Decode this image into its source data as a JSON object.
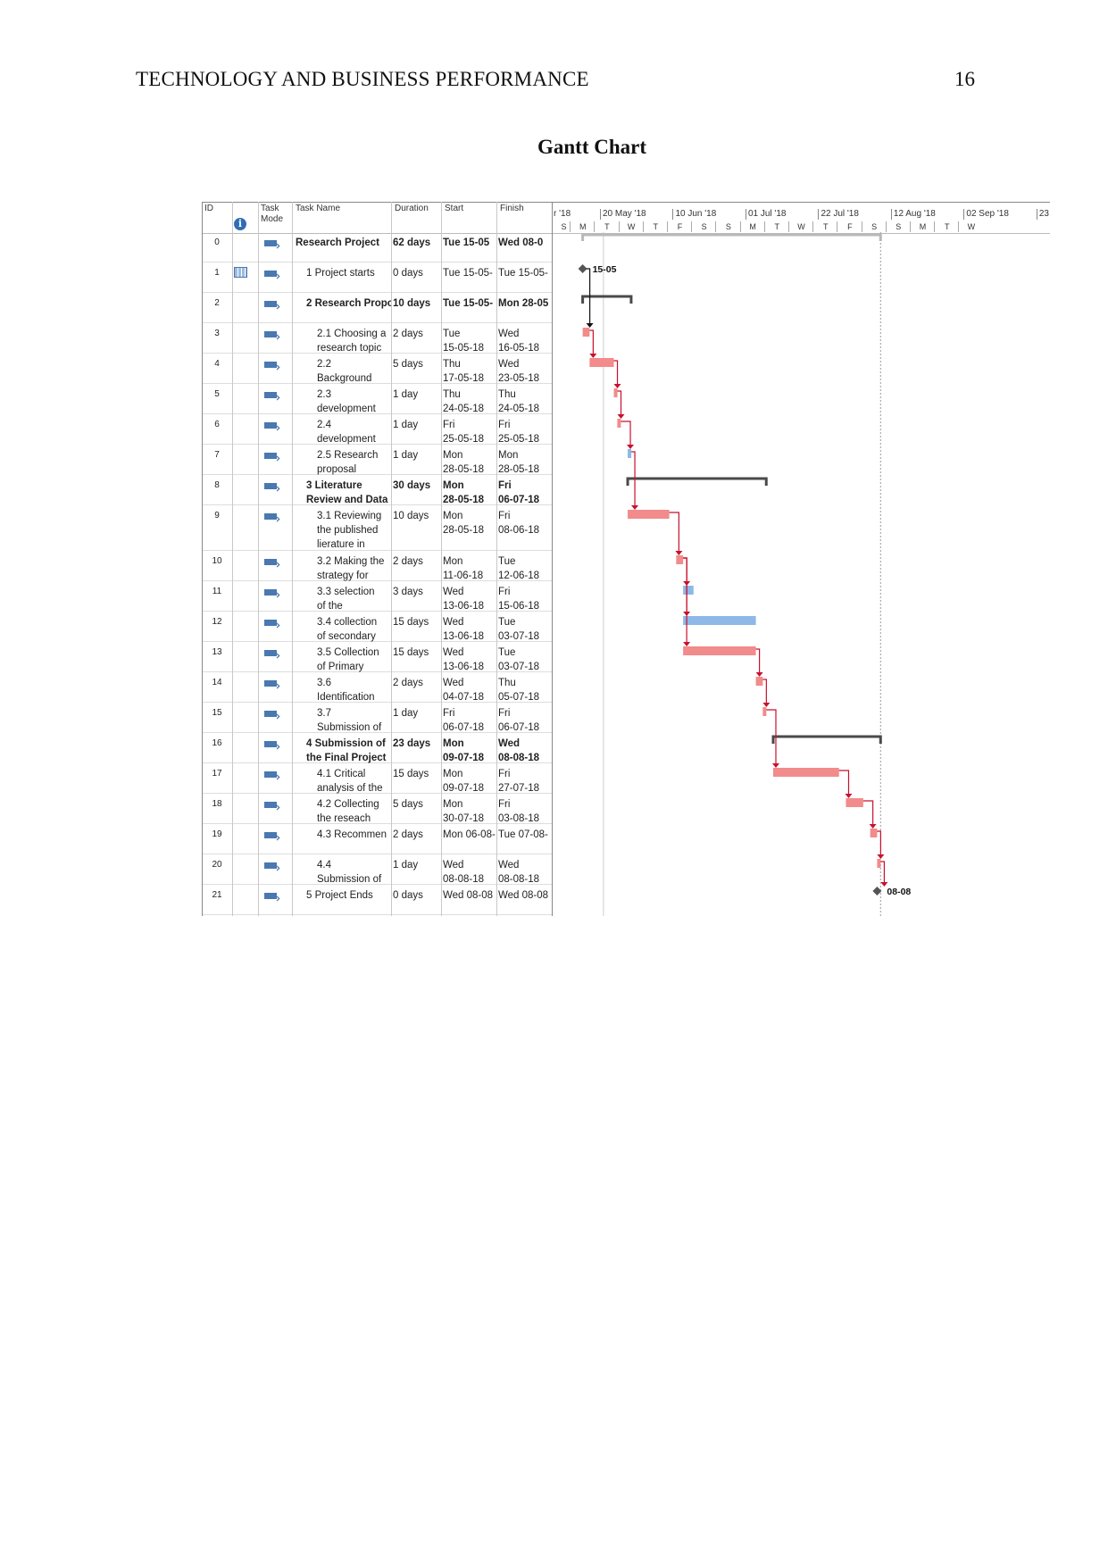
{
  "page": {
    "running_head": "TECHNOLOGY AND BUSINESS PERFORMANCE",
    "page_number": "16",
    "title": "Gantt Chart"
  },
  "table": {
    "headers": {
      "id": "ID",
      "info": "i",
      "mode": "Task\nMode",
      "name": "Task Name",
      "duration": "Duration",
      "start": "Start",
      "finish": "Finish"
    },
    "rows": [
      {
        "id": "0",
        "name": "Research Project",
        "level": 0,
        "bold": true,
        "duration": "62 days",
        "start": "Tue 15-05",
        "finish": "Wed 08-0",
        "s": "2018-05-15",
        "f": "2018-08-08",
        "type": "project"
      },
      {
        "id": "1",
        "name": "1 Project starts",
        "level": 1,
        "bold": false,
        "duration": "0 days",
        "start": "Tue 15-05-",
        "finish": "Tue 15-05-",
        "s": "2018-05-15",
        "f": "2018-05-15",
        "type": "milestone",
        "label": "15-05",
        "indicator": "calendar"
      },
      {
        "id": "2",
        "name": "2 Research Propo",
        "level": 1,
        "bold": true,
        "duration": "10 days",
        "start": "Tue 15-05-",
        "finish": "Mon 28-05",
        "s": "2018-05-15",
        "f": "2018-05-28",
        "type": "summary"
      },
      {
        "id": "3",
        "name": "2.1 Choosing a\nresearch topic",
        "level": 2,
        "bold": false,
        "duration": "2 days",
        "start": "Tue\n15-05-18",
        "finish": "Wed\n16-05-18",
        "s": "2018-05-15",
        "f": "2018-05-16",
        "type": "critical"
      },
      {
        "id": "4",
        "name": "2.2\nBackground",
        "level": 2,
        "bold": false,
        "duration": "5 days",
        "start": "Thu\n17-05-18",
        "finish": "Wed\n23-05-18",
        "s": "2018-05-17",
        "f": "2018-05-23",
        "type": "critical"
      },
      {
        "id": "5",
        "name": "2.3\ndevelopment",
        "level": 2,
        "bold": false,
        "duration": "1 day",
        "start": "Thu\n24-05-18",
        "finish": "Thu\n24-05-18",
        "s": "2018-05-24",
        "f": "2018-05-24",
        "type": "critical"
      },
      {
        "id": "6",
        "name": "2.4\ndevelopment",
        "level": 2,
        "bold": false,
        "duration": "1 day",
        "start": "Fri\n25-05-18",
        "finish": "Fri\n25-05-18",
        "s": "2018-05-25",
        "f": "2018-05-25",
        "type": "critical"
      },
      {
        "id": "7",
        "name": "2.5 Research\nproposal",
        "level": 2,
        "bold": false,
        "duration": "1 day",
        "start": "Mon\n28-05-18",
        "finish": "Mon\n28-05-18",
        "s": "2018-05-28",
        "f": "2018-05-28",
        "type": "normal"
      },
      {
        "id": "8",
        "name": "3 Literature\nReview and Data",
        "level": 1,
        "bold": true,
        "duration": "30 days",
        "start": "Mon\n28-05-18",
        "finish": "Fri\n06-07-18",
        "s": "2018-05-28",
        "f": "2018-07-06",
        "type": "summary"
      },
      {
        "id": "9",
        "name": "3.1 Reviewing\nthe published\nlierature in",
        "level": 2,
        "bold": false,
        "duration": "10 days",
        "start": "Mon\n28-05-18",
        "finish": "Fri\n08-06-18",
        "s": "2018-05-28",
        "f": "2018-06-08",
        "type": "critical",
        "tall": true
      },
      {
        "id": "10",
        "name": "3.2 Making the\nstrategy for",
        "level": 2,
        "bold": false,
        "duration": "2 days",
        "start": "Mon\n11-06-18",
        "finish": "Tue\n12-06-18",
        "s": "2018-06-11",
        "f": "2018-06-12",
        "type": "critical"
      },
      {
        "id": "11",
        "name": "3.3 selection\nof the",
        "level": 2,
        "bold": false,
        "duration": "3 days",
        "start": "Wed\n13-06-18",
        "finish": "Fri\n15-06-18",
        "s": "2018-06-13",
        "f": "2018-06-15",
        "type": "normal"
      },
      {
        "id": "12",
        "name": "3.4 collection\nof secondary",
        "level": 2,
        "bold": false,
        "duration": "15 days",
        "start": "Wed\n13-06-18",
        "finish": "Tue\n03-07-18",
        "s": "2018-06-13",
        "f": "2018-07-03",
        "type": "normal"
      },
      {
        "id": "13",
        "name": "3.5 Collection\nof Primary",
        "level": 2,
        "bold": false,
        "duration": "15 days",
        "start": "Wed\n13-06-18",
        "finish": "Tue\n03-07-18",
        "s": "2018-06-13",
        "f": "2018-07-03",
        "type": "critical"
      },
      {
        "id": "14",
        "name": "3.6\nIdentification",
        "level": 2,
        "bold": false,
        "duration": "2 days",
        "start": "Wed\n04-07-18",
        "finish": "Thu\n05-07-18",
        "s": "2018-07-04",
        "f": "2018-07-05",
        "type": "critical"
      },
      {
        "id": "15",
        "name": "3.7\nSubmission of",
        "level": 2,
        "bold": false,
        "duration": "1 day",
        "start": "Fri\n06-07-18",
        "finish": "Fri\n06-07-18",
        "s": "2018-07-06",
        "f": "2018-07-06",
        "type": "critical"
      },
      {
        "id": "16",
        "name": "4 Submission of\nthe Final Project",
        "level": 1,
        "bold": true,
        "duration": "23 days",
        "start": "Mon\n09-07-18",
        "finish": "Wed\n08-08-18",
        "s": "2018-07-09",
        "f": "2018-08-08",
        "type": "summary"
      },
      {
        "id": "17",
        "name": "4.1 Critical\nanalysis of the",
        "level": 2,
        "bold": false,
        "duration": "15 days",
        "start": "Mon\n09-07-18",
        "finish": "Fri\n27-07-18",
        "s": "2018-07-09",
        "f": "2018-07-27",
        "type": "critical"
      },
      {
        "id": "18",
        "name": "4.2 Collecting\nthe reseach",
        "level": 2,
        "bold": false,
        "duration": "5 days",
        "start": "Mon\n30-07-18",
        "finish": "Fri\n03-08-18",
        "s": "2018-07-30",
        "f": "2018-08-03",
        "type": "critical"
      },
      {
        "id": "19",
        "name": "4.3 Recommen",
        "level": 2,
        "bold": false,
        "duration": "2 days",
        "start": "Mon 06-08-",
        "finish": "Tue 07-08-",
        "s": "2018-08-06",
        "f": "2018-08-07",
        "type": "critical"
      },
      {
        "id": "20",
        "name": "4.4\nSubmission of",
        "level": 2,
        "bold": false,
        "duration": "1 day",
        "start": "Wed\n08-08-18",
        "finish": "Wed\n08-08-18",
        "s": "2018-08-08",
        "f": "2018-08-08",
        "type": "critical"
      },
      {
        "id": "21",
        "name": "5 Project Ends",
        "level": 1,
        "bold": false,
        "duration": "0 days",
        "start": "Wed 08-08",
        "finish": "Wed 08-08",
        "s": "2018-08-08",
        "f": "2018-08-08",
        "type": "milestone",
        "label": "08-08"
      }
    ]
  },
  "timescale": {
    "major": [
      {
        "label": "r '18",
        "date": "2018-04-29"
      },
      {
        "label": "20 May '18",
        "date": "2018-05-20"
      },
      {
        "label": "10 Jun '18",
        "date": "2018-06-10"
      },
      {
        "label": "01 Jul '18",
        "date": "2018-07-01"
      },
      {
        "label": "22 Jul '18",
        "date": "2018-07-22"
      },
      {
        "label": "12 Aug '18",
        "date": "2018-08-12"
      },
      {
        "label": "02 Sep '18",
        "date": "2018-09-02"
      },
      {
        "label": "23",
        "date": "2018-09-23"
      }
    ],
    "minor": [
      "S",
      "M",
      "T",
      "W",
      "T",
      "F",
      "S",
      "S",
      "M",
      "T",
      "W",
      "T",
      "F",
      "S",
      "S",
      "M",
      "T",
      "W"
    ]
  },
  "links": [
    [
      1,
      3
    ],
    [
      3,
      4
    ],
    [
      4,
      5
    ],
    [
      5,
      6
    ],
    [
      6,
      7
    ],
    [
      7,
      9
    ],
    [
      9,
      10
    ],
    [
      10,
      11
    ],
    [
      10,
      12
    ],
    [
      10,
      13
    ],
    [
      13,
      14
    ],
    [
      14,
      15
    ],
    [
      15,
      17
    ],
    [
      17,
      18
    ],
    [
      18,
      19
    ],
    [
      19,
      20
    ],
    [
      20,
      21
    ]
  ],
  "colors": {
    "critical": "#f28b8b",
    "normal": "#8db8e8",
    "summary": "#4a4a4a",
    "project": "#b8b8b8",
    "link_critical": "#c8102e",
    "link_normal": "#111111",
    "milestone": "#555555"
  }
}
